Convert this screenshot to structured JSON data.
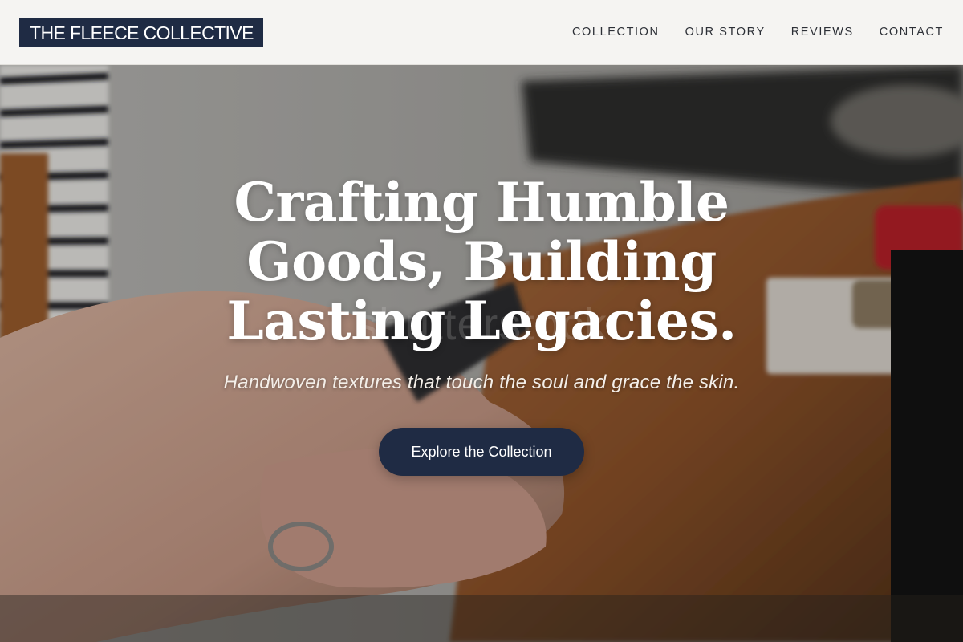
{
  "header": {
    "logo_text": "THE FLEECE COLLECTIVE",
    "nav": [
      {
        "label": "COLLECTION"
      },
      {
        "label": "OUR STORY"
      },
      {
        "label": "REVIEWS"
      },
      {
        "label": "CONTACT"
      }
    ]
  },
  "hero": {
    "title": "Crafting Humble Goods, Building Lasting Legacies.",
    "subtitle": "Handwoven textures that touch the soul and grace the skin.",
    "cta_label": "Explore the Collection",
    "watermark_text": "shutterstock"
  },
  "colors": {
    "brand_navy": "#1f2b44",
    "header_bg": "#f5f4f2",
    "hero_text": "#ffffff"
  }
}
